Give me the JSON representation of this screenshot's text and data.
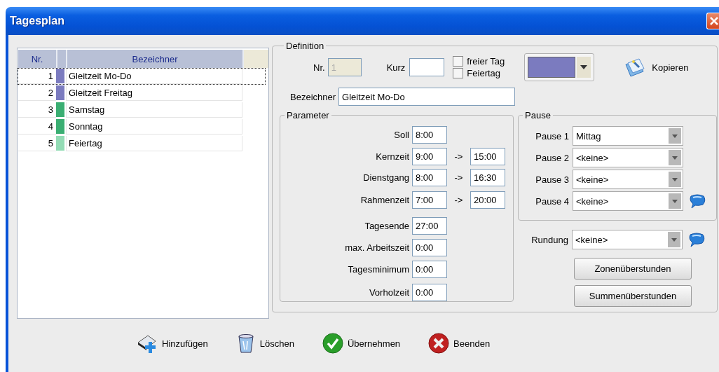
{
  "window": {
    "title": "Tagesplan"
  },
  "list": {
    "columns": [
      {
        "label": "Nr."
      },
      {
        "label": "Bezeichner"
      }
    ],
    "rows": [
      {
        "nr": "1",
        "color": "#7b7bbf",
        "name": "Gleitzeit Mo-Do",
        "selected": true
      },
      {
        "nr": "2",
        "color": "#7b7bbf",
        "name": "Gleitzeit Freitag",
        "selected": false
      },
      {
        "nr": "3",
        "color": "#3aae72",
        "name": "Samstag",
        "selected": false
      },
      {
        "nr": "4",
        "color": "#3aae72",
        "name": "Sonntag",
        "selected": false
      },
      {
        "nr": "5",
        "color": "#93dcb5",
        "name": "Feiertag",
        "selected": false
      }
    ]
  },
  "definition": {
    "title": "Definition",
    "nr": {
      "label": "Nr.",
      "value": "1",
      "disabled": true
    },
    "kurz": {
      "label": "Kurz",
      "disabled": false
    },
    "checkboxes": [
      {
        "label": "freier Tag",
        "checked": false
      },
      {
        "label": "Feiertag",
        "checked": false
      }
    ],
    "color": "#7b7bbf",
    "copy_button": "Kopieren",
    "bezeichner": {
      "label": "Bezeichner",
      "value": "Gleitzeit Mo-Do"
    },
    "parameter": {
      "title": "Parameter",
      "rows": [
        {
          "label": "Soll",
          "value": "8:00"
        },
        {
          "label": "Kernzeit",
          "value": "9:00",
          "arrow": "->",
          "to_value": "15:00"
        },
        {
          "label": "Dienstgang",
          "value": "8:00",
          "arrow": "->",
          "to_value": "16:30"
        },
        {
          "label": "Rahmenzeit",
          "value": "7:00",
          "arrow": "->",
          "to_value": "20:00"
        },
        {
          "label": "Tagesende",
          "value": "27:00"
        },
        {
          "label": "max. Arbeitszeit",
          "value": "0:00"
        },
        {
          "label": "Tagesminimum",
          "value": "0:00"
        },
        {
          "label": "Vorholzeit",
          "value": "0:00"
        }
      ]
    },
    "pause": {
      "title": "Pause",
      "rows": [
        {
          "label": "Pause 1",
          "value": "Mittag",
          "help": false
        },
        {
          "label": "Pause 2",
          "value": "<keine>",
          "help": false
        },
        {
          "label": "Pause 3",
          "value": "<keine>",
          "help": false
        },
        {
          "label": "Pause 4",
          "value": "<keine>",
          "help": true
        }
      ]
    },
    "rundung": {
      "label": "Rundung",
      "value": "<keine>",
      "help": true
    },
    "buttons": [
      "Zonenüberstunden",
      "Summenüberstunden"
    ]
  },
  "actions": [
    {
      "kind": "add",
      "label": "Hinzufügen"
    },
    {
      "kind": "delete",
      "label": "Löschen"
    },
    {
      "kind": "apply",
      "label": "Übernehmen"
    },
    {
      "kind": "close",
      "label": "Beenden"
    }
  ]
}
